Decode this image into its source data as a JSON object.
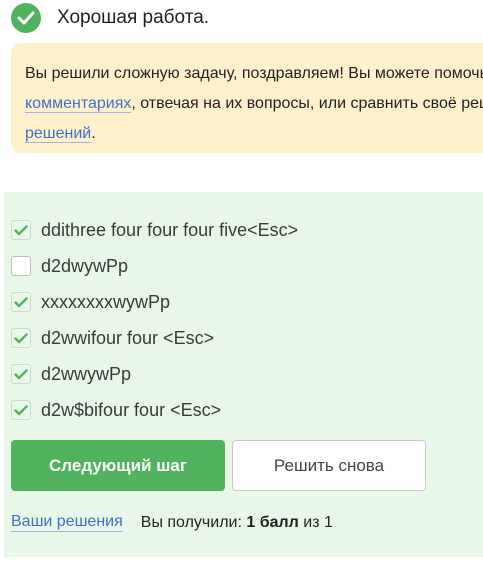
{
  "status": {
    "text": "Хорошая работа.",
    "icon": "check-circle-icon",
    "color": "#52b35f"
  },
  "notice": {
    "line1": "Вы решили сложную задачу, поздравляем! Вы можете помочь другим учащимся в",
    "link1": "комментариях",
    "line2_rest": ", отвечая на их вопросы, или сравнить своё решение с другими на форуме",
    "link2": "решений",
    "line3_rest": ".",
    "background": "#fff0cc"
  },
  "options": [
    {
      "label": "ddithree four four four five<Esc>",
      "checked": true
    },
    {
      "label": "d2dwywPp",
      "checked": false
    },
    {
      "label": "xxxxxxxxwywPp",
      "checked": true
    },
    {
      "label": "d2wwifour four <Esc>",
      "checked": true
    },
    {
      "label": "d2wwywPp",
      "checked": true
    },
    {
      "label": "d2w$bifour four <Esc>",
      "checked": true
    }
  ],
  "buttons": {
    "next": "Следующий шаг",
    "retry": "Решить снова"
  },
  "footer": {
    "link": "Ваши решения",
    "score_prefix": "Вы получили: ",
    "score_value": "1 балл",
    "score_suffix": " из 1"
  },
  "colors": {
    "accent": "#52b35f",
    "link": "#3f71c9",
    "quiz_bg": "#e9f7e9"
  }
}
